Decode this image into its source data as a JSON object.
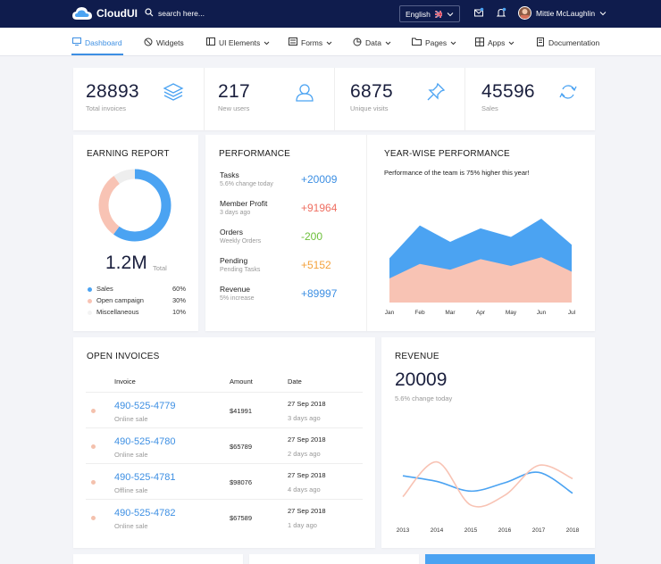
{
  "brand": {
    "name": "CloudUI"
  },
  "search": {
    "placeholder": "search here..."
  },
  "language": {
    "label": "English"
  },
  "user": {
    "name": "Mittie McLaughlin"
  },
  "nav": [
    {
      "label": "Dashboard",
      "icon": "monitor-icon",
      "active": true
    },
    {
      "label": "Widgets",
      "icon": "widget-icon"
    },
    {
      "label": "UI Elements",
      "icon": "ui-icon"
    },
    {
      "label": "Forms",
      "icon": "form-icon"
    },
    {
      "label": "Data",
      "icon": "data-icon"
    },
    {
      "label": "Pages",
      "icon": "folder-icon"
    },
    {
      "label": "Apps",
      "icon": "apps-icon"
    },
    {
      "label": "Documentation",
      "icon": "doc-icon"
    }
  ],
  "stats": [
    {
      "value": "28893",
      "label": "Total invoices",
      "icon": "layers-icon"
    },
    {
      "value": "217",
      "label": "New users",
      "icon": "user-icon"
    },
    {
      "value": "6875",
      "label": "Unique visits",
      "icon": "pin-icon"
    },
    {
      "value": "45596",
      "label": "Sales",
      "icon": "refresh-icon"
    }
  ],
  "earning": {
    "title": "EARNING REPORT",
    "total": "1.2M",
    "total_label": "Total",
    "legend": [
      {
        "label": "Sales",
        "pct": "60%",
        "color": "#4ba3f2"
      },
      {
        "label": "Open campaign",
        "pct": "30%",
        "color": "#f8c3b4"
      },
      {
        "label": "Miscellaneous",
        "pct": "10%",
        "color": "#eeeeee"
      }
    ]
  },
  "performance": {
    "title": "PERFORMANCE",
    "rows": [
      {
        "title": "Tasks",
        "sub": "5.6% change today",
        "value": "+20009",
        "color": "#3d8fe3"
      },
      {
        "title": "Member Profit",
        "sub": "3 days ago",
        "value": "+91964",
        "color": "#ef6f62"
      },
      {
        "title": "Orders",
        "sub": "Weekly Orders",
        "value": "-200",
        "color": "#6cbf3a"
      },
      {
        "title": "Pending",
        "sub": "Pending Tasks",
        "value": "+5152",
        "color": "#f4a23c"
      },
      {
        "title": "Revenue",
        "sub": "5% increase",
        "value": "+89997",
        "color": "#3d8fe3"
      }
    ]
  },
  "yearwise": {
    "title": "YEAR-WISE PERFORMANCE",
    "subtitle": "Performance of the team is 75% higher this year!"
  },
  "invoices": {
    "title": "OPEN INVOICES",
    "headers": [
      "Invoice",
      "Amount",
      "Date"
    ],
    "rows": [
      {
        "number": "490-525-4779",
        "type": "Online sale",
        "amount": "$41991",
        "date": "27 Sep 2018",
        "ago": "3 days ago"
      },
      {
        "number": "490-525-4780",
        "type": "Online sale",
        "amount": "$65789",
        "date": "27 Sep 2018",
        "ago": "2 days ago"
      },
      {
        "number": "490-525-4781",
        "type": "Offline sale",
        "amount": "$98076",
        "date": "27 Sep 2018",
        "ago": "4 days ago"
      },
      {
        "number": "490-525-4782",
        "type": "Online sale",
        "amount": "$67589",
        "date": "27 Sep 2018",
        "ago": "1 day ago"
      }
    ]
  },
  "revenue": {
    "title": "REVENUE",
    "value": "20009",
    "sub": "5.6% change today"
  },
  "chart_data": [
    {
      "type": "donut",
      "values": [
        60,
        30,
        10
      ],
      "labels": [
        "Sales",
        "Open campaign",
        "Miscellaneous"
      ],
      "colors": [
        "#4ba3f2",
        "#f8c3b4",
        "#eeeeee"
      ]
    },
    {
      "type": "area",
      "categories": [
        "Jan",
        "Feb",
        "Mar",
        "Apr",
        "May",
        "Jun",
        "Jul"
      ],
      "series": [
        {
          "values": [
            46,
            80,
            63,
            77,
            68,
            87,
            60
          ],
          "color": "#4ba3f2"
        },
        {
          "values": [
            25,
            40,
            34,
            45,
            38,
            47,
            32
          ],
          "color": "#f8c3b4"
        }
      ],
      "ylim": [
        0,
        100
      ],
      "grid": false
    },
    {
      "type": "line",
      "categories": [
        "2013",
        "2014",
        "2015",
        "2016",
        "2017",
        "2018"
      ],
      "series": [
        {
          "values": [
            60,
            52,
            38,
            50,
            65,
            35
          ],
          "color": "#4ba3f2"
        },
        {
          "values": [
            30,
            80,
            18,
            32,
            75,
            56
          ],
          "color": "#f8c3b4"
        }
      ],
      "ylim": [
        0,
        100
      ],
      "grid": false
    }
  ]
}
